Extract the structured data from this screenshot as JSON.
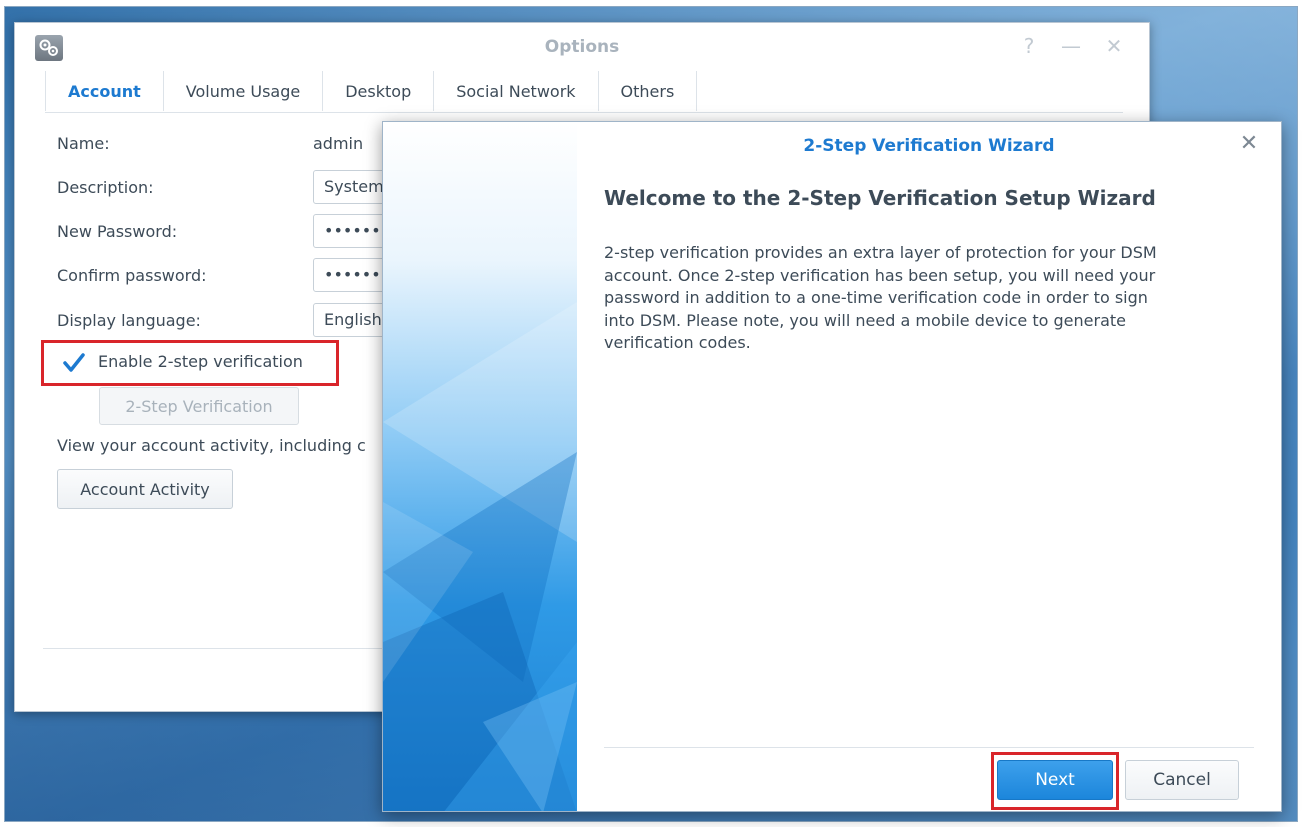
{
  "options": {
    "title": "Options",
    "controls": {
      "help": "?",
      "minimize": "—",
      "close": "✕"
    },
    "tabs": [
      {
        "label": "Account"
      },
      {
        "label": "Volume Usage"
      },
      {
        "label": "Desktop"
      },
      {
        "label": "Social Network"
      },
      {
        "label": "Others"
      }
    ],
    "form": {
      "name_label": "Name:",
      "name_value": "admin",
      "description_label": "Description:",
      "description_value": "System",
      "new_password_label": "New Password:",
      "new_password_value": "••••••",
      "confirm_password_label": "Confirm password:",
      "confirm_password_value": "••••••",
      "display_language_label": "Display language:",
      "display_language_value": "English"
    },
    "two_step": {
      "checkbox_label": "Enable 2-step verification",
      "checked": true,
      "button_label": "2-Step Verification"
    },
    "activity_text": "View your account activity, including c",
    "activity_button_label": "Account Activity"
  },
  "wizard": {
    "title": "2-Step Verification Wizard",
    "close": "✕",
    "heading": "Welcome to the 2-Step Verification Setup Wizard",
    "body_lines": [
      "2-step verification provides an extra layer of protection for your DSM",
      "account. Once 2-step verification has been setup, you will need your",
      "password in addition to a one-time verification code in order to sign",
      "into DSM. Please note, you will need a mobile device to generate",
      "verification codes."
    ],
    "next_label": "Next",
    "cancel_label": "Cancel"
  },
  "colors": {
    "accent": "#1d7ad0",
    "highlight": "#d9252a",
    "primary_button": "#2a93e3"
  }
}
